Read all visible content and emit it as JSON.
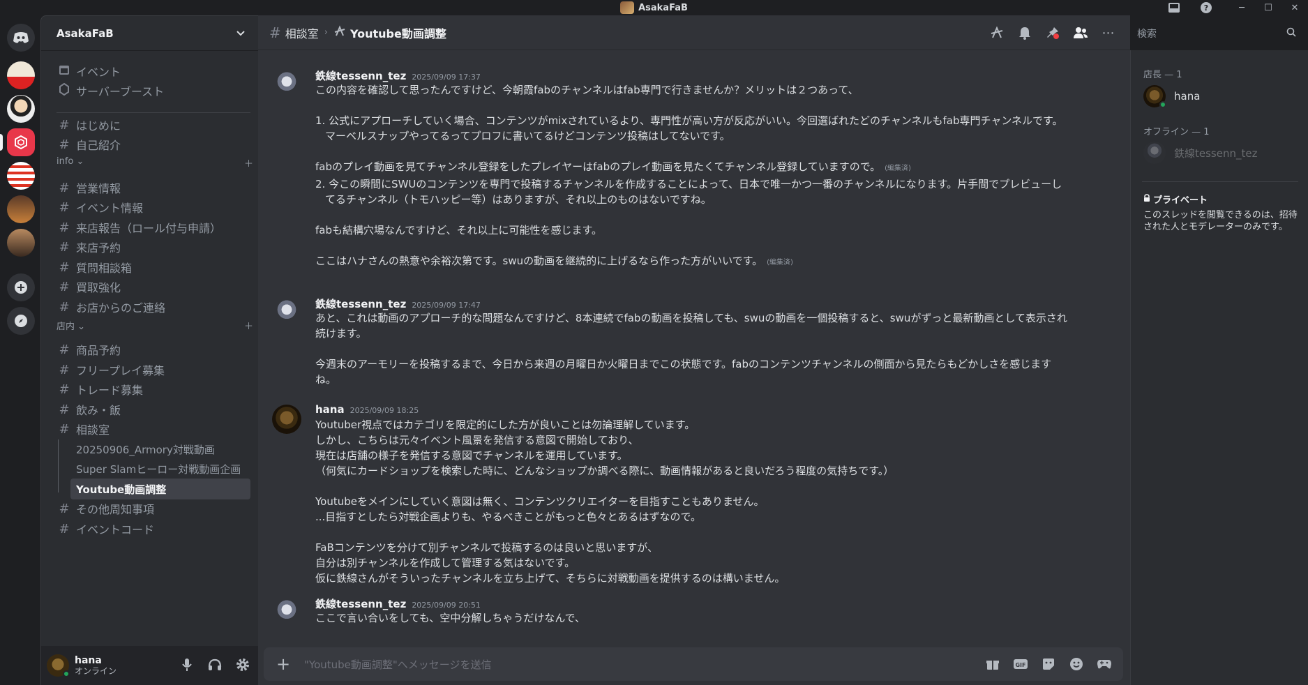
{
  "app": {
    "title": "AsakaFaB"
  },
  "server": {
    "name": "AsakaFaB"
  },
  "sidebar": {
    "top_items": [
      {
        "label": "イベント",
        "icon": "calendar-icon"
      },
      {
        "label": "サーバーブースト",
        "icon": "boost-icon"
      }
    ],
    "channels_top": [
      "はじめに",
      "自己紹介"
    ],
    "category_info": "info",
    "channels_info": [
      "営業情報",
      "イベント情報",
      "来店報告（ロール付与申請）",
      "来店予約",
      "質問相談箱",
      "買取強化",
      "お店からのご連絡"
    ],
    "category_store": "店内",
    "channels_store_a": [
      "商品予約",
      "フリープレイ募集",
      "トレード募集",
      "飲み・飯",
      "相談室"
    ],
    "threads": [
      "20250906_Armory対戦動画",
      "Super Slamヒーロー対戦動画企画",
      "Youtube動画調整"
    ],
    "channels_store_b": [
      "その他周知事項",
      "イベントコード"
    ]
  },
  "user": {
    "name": "hana",
    "status": "オンライン"
  },
  "header": {
    "parent_channel": "相談室",
    "thread": "Youtube動画調整",
    "search_placeholder": "検索"
  },
  "messages": [
    {
      "author": "鉄線tessenn_tez",
      "time": "2025/09/09 17:37",
      "avatar": "tessen",
      "lines": [
        {
          "t": "この内容を確認して思ったんですけど、今朝霞fabのチャンネルはfab専門で行きませんか？メリットは２つあって、"
        },
        {
          "t": ""
        },
        {
          "t": "1. 公式にアプローチしていく場合、コンテンツがmixされているより、専門性が高い方が反応がいい。今回選ばれたどのチャンネルもfab専門チャンネルです。"
        },
        {
          "t": "マーベルスナップやってるってプロフに書いてるけどコンテンツ投稿はしてないです。",
          "ind": true
        },
        {
          "t": ""
        },
        {
          "t": "fabのプレイ動画を見てチャンネル登録をしたプレイヤーはfabのプレイ動画を見たくてチャンネル登録していますので。",
          "edited": "(編集済)"
        },
        {
          "t": "2. 今この瞬間にSWUのコンテンツを専門で投稿するチャンネルを作成することによって、日本で唯一かつ一番のチャンネルになります。片手間でプレビューし"
        },
        {
          "t": "てるチャンネル（トモハッピー等）はありますが、それ以上のものはないですね。",
          "ind": true
        },
        {
          "t": ""
        },
        {
          "t": "fabも結構穴場なんですけど、それ以上に可能性を感じます。"
        },
        {
          "t": ""
        },
        {
          "t": "ここはハナさんの熱意や余裕次第です。swuの動画を継続的に上げるなら作った方がいいです。",
          "edited": "(編集済)"
        }
      ]
    },
    {
      "author": "鉄線tessenn_tez",
      "time": "2025/09/09 17:47",
      "avatar": "tessen",
      "lines": [
        {
          "t": "あと、これは動画のアプローチ的な問題なんですけど、8本連続でfabの動画を投稿しても、swuの動画を一個投稿すると、swuがずっと最新動画として表示され"
        },
        {
          "t": "続けます。"
        },
        {
          "t": ""
        },
        {
          "t": "今週末のアーモリーを投稿するまで、今日から来週の月曜日か火曜日までこの状態です。fabのコンテンツチャンネルの側面から見たらもどかしさを感じます"
        },
        {
          "t": "ね。"
        }
      ]
    },
    {
      "author": "hana",
      "time": "2025/09/09 18:25",
      "avatar": "hana",
      "lines": [
        {
          "t": "Youtuber視点ではカテゴリを限定的にした方が良いことは勿論理解しています。"
        },
        {
          "t": "しかし、こちらは元々イベント風景を発信する意図で開始しており、"
        },
        {
          "t": "現在は店舗の様子を発信する意図でチャンネルを運用しています。"
        },
        {
          "t": "（何気にカードショップを検索した時に、どんなショップか調べる際に、動画情報があると良いだろう程度の気持ちです。）"
        },
        {
          "t": ""
        },
        {
          "t": "Youtubeをメインにしていく意図は無く、コンテンツクリエイターを目指すこともありません。"
        },
        {
          "t": "...目指すとしたら対戦企画よりも、やるべきことがもっと色々とあるはずなので。"
        },
        {
          "t": ""
        },
        {
          "t": "FaBコンテンツを分けて別チャンネルで投稿するのは良いと思いますが、"
        },
        {
          "t": "自分は別チャンネルを作成して管理する気はないです。"
        },
        {
          "t": "仮に鉄線さんがそういったチャンネルを立ち上げて、そちらに対戦動画を提供するのは構いません。"
        }
      ]
    },
    {
      "author": "鉄線tessenn_tez",
      "time": "2025/09/09 20:51",
      "avatar": "tessen",
      "lines": [
        {
          "t": "ここで言い合いをしても、空中分解しちゃうだけなんで、"
        }
      ]
    }
  ],
  "composer": {
    "placeholder": "\"Youtube動画調整\"へメッセージを送信"
  },
  "members": {
    "group_owner": "店長 — 1",
    "owner_name": "hana",
    "group_offline": "オフライン — 1",
    "offline_name": "鉄線tessenn_tez",
    "private_title": "プライベート",
    "private_desc": "このスレッドを閲覧できるのは、招待された人とモデレーターのみです。"
  },
  "colors": {
    "accent": "#5865f2",
    "online": "#23a55a",
    "background": "#313338",
    "sidebar": "#2b2d31"
  }
}
